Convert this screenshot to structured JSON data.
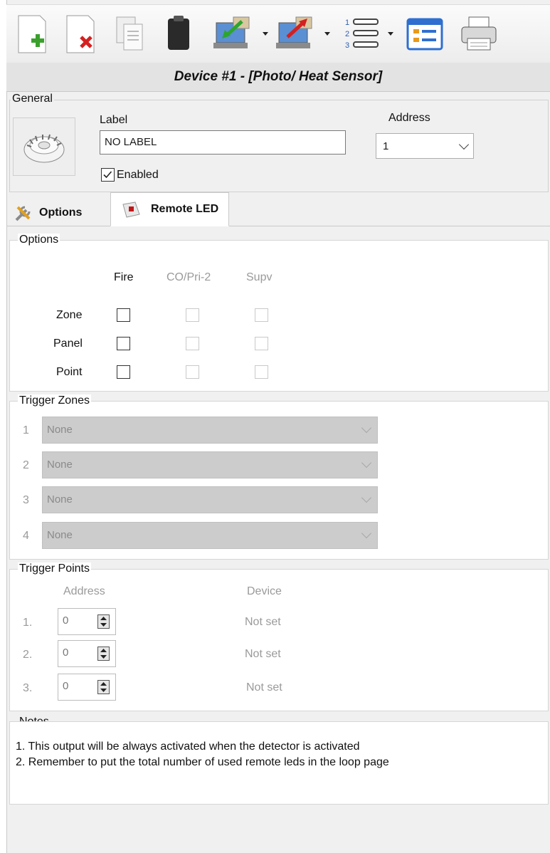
{
  "toolbar": {
    "buttons": [
      {
        "name": "add-device-icon"
      },
      {
        "name": "delete-device-icon"
      },
      {
        "name": "copy-icon"
      },
      {
        "name": "paste-icon"
      },
      {
        "name": "download-icon"
      },
      {
        "name": "upload-icon"
      },
      {
        "name": "list-icon"
      },
      {
        "name": "properties-icon"
      },
      {
        "name": "printer-icon"
      }
    ]
  },
  "title": "Device #1 - [Photo/ Heat Sensor]",
  "general": {
    "group_label": "General",
    "label_caption": "Label",
    "label_value": "NO LABEL",
    "address_caption": "Address",
    "address_value": "1",
    "enabled_label": "Enabled",
    "enabled_checked": true
  },
  "tabs": {
    "options": "Options",
    "remote_led": "Remote LED",
    "active": "remote_led"
  },
  "options": {
    "group_label": "Options",
    "columns": [
      "Fire",
      "CO/Pri-2",
      "Supv"
    ],
    "rows": [
      "Zone",
      "Panel",
      "Point"
    ]
  },
  "trigger_zones": {
    "group_label": "Trigger Zones",
    "items": [
      {
        "num": "1",
        "value": "None"
      },
      {
        "num": "2",
        "value": "None"
      },
      {
        "num": "3",
        "value": "None"
      },
      {
        "num": "4",
        "value": "None"
      }
    ]
  },
  "trigger_points": {
    "group_label": "Trigger Points",
    "address_header": "Address",
    "device_header": "Device",
    "items": [
      {
        "num": "1.",
        "address": "0",
        "device": "Not set"
      },
      {
        "num": "2.",
        "address": "0",
        "device": "Not set"
      },
      {
        "num": "3.",
        "address": "0",
        "device": "Not set"
      }
    ]
  },
  "notes": {
    "group_label": "Notes",
    "lines": [
      "1. This output will be always activated when the detector is activated",
      "2. Remember to put the total number of used remote leds in the loop page"
    ]
  }
}
